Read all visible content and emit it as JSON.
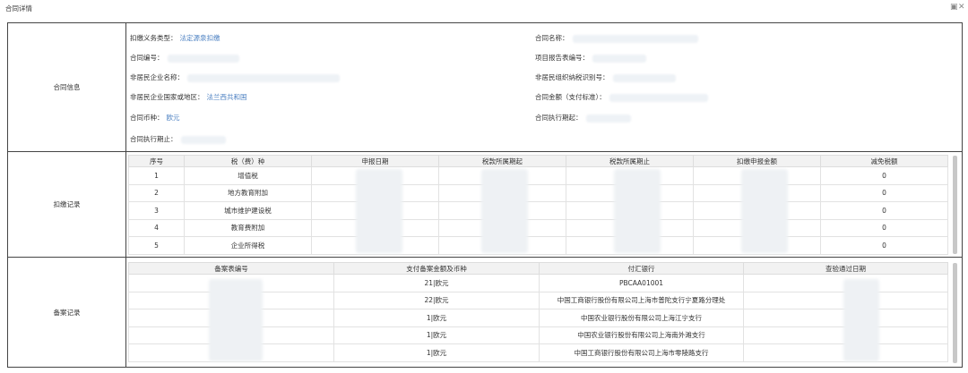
{
  "window": {
    "title": "合同详情",
    "restore_icon": "restore-window-icon",
    "close_icon": "close-icon"
  },
  "contract_info": {
    "section_label": "合同信息",
    "withholding_type": {
      "label": "扣缴义务类型：",
      "value": "法定源泉扣缴"
    },
    "contract_name": {
      "label": "合同名称："
    },
    "contract_no": {
      "label": "合同编号："
    },
    "project_report_no": {
      "label": "项目报告表编号："
    },
    "nonresident_name": {
      "label": "非居民企业名称："
    },
    "nonresident_taxid": {
      "label": "非居民组织纳税识别号："
    },
    "nonresident_country": {
      "label": "非居民企业国家或地区：",
      "value": "法兰西共和国"
    },
    "contract_amount": {
      "label": "合同金额（支付标准）："
    },
    "currency": {
      "label": "合同币种：",
      "value": "欧元"
    },
    "exec_start": {
      "label": "合同执行期起："
    },
    "exec_end": {
      "label": "合同执行期止："
    }
  },
  "deduction_records": {
    "section_label": "扣缴记录",
    "columns": [
      "序号",
      "税（费）种",
      "申报日期",
      "税款所属期起",
      "税款所属期止",
      "扣缴申报金额",
      "减免税额"
    ],
    "rows": [
      {
        "no": "1",
        "tax": "增值税",
        "relief": "0"
      },
      {
        "no": "2",
        "tax": "地方教育附加",
        "relief": "0"
      },
      {
        "no": "3",
        "tax": "城市维护建设税",
        "relief": "0"
      },
      {
        "no": "4",
        "tax": "教育费附加",
        "relief": "0"
      },
      {
        "no": "5",
        "tax": "企业所得税",
        "relief": "0"
      }
    ]
  },
  "filing_records": {
    "section_label": "备案记录",
    "columns": [
      "备案表编号",
      "支付备案金额及币种",
      "付汇银行",
      "查验通过日期"
    ],
    "rows": [
      {
        "amount": "21|欧元",
        "bank": "PBCAA01001"
      },
      {
        "amount": "22|欧元",
        "bank": "中国工商银行股份有限公司上海市普陀支行宁夏路分理处"
      },
      {
        "amount": "1|欧元",
        "bank": "中国农业银行股份有限公司上海江宁支行"
      },
      {
        "amount": "1|欧元",
        "bank": "中国农业银行股份有限公司上海南外滩支行"
      },
      {
        "amount": "1|欧元",
        "bank": "中国工商银行股份有限公司上海市零陵路支行"
      }
    ]
  }
}
